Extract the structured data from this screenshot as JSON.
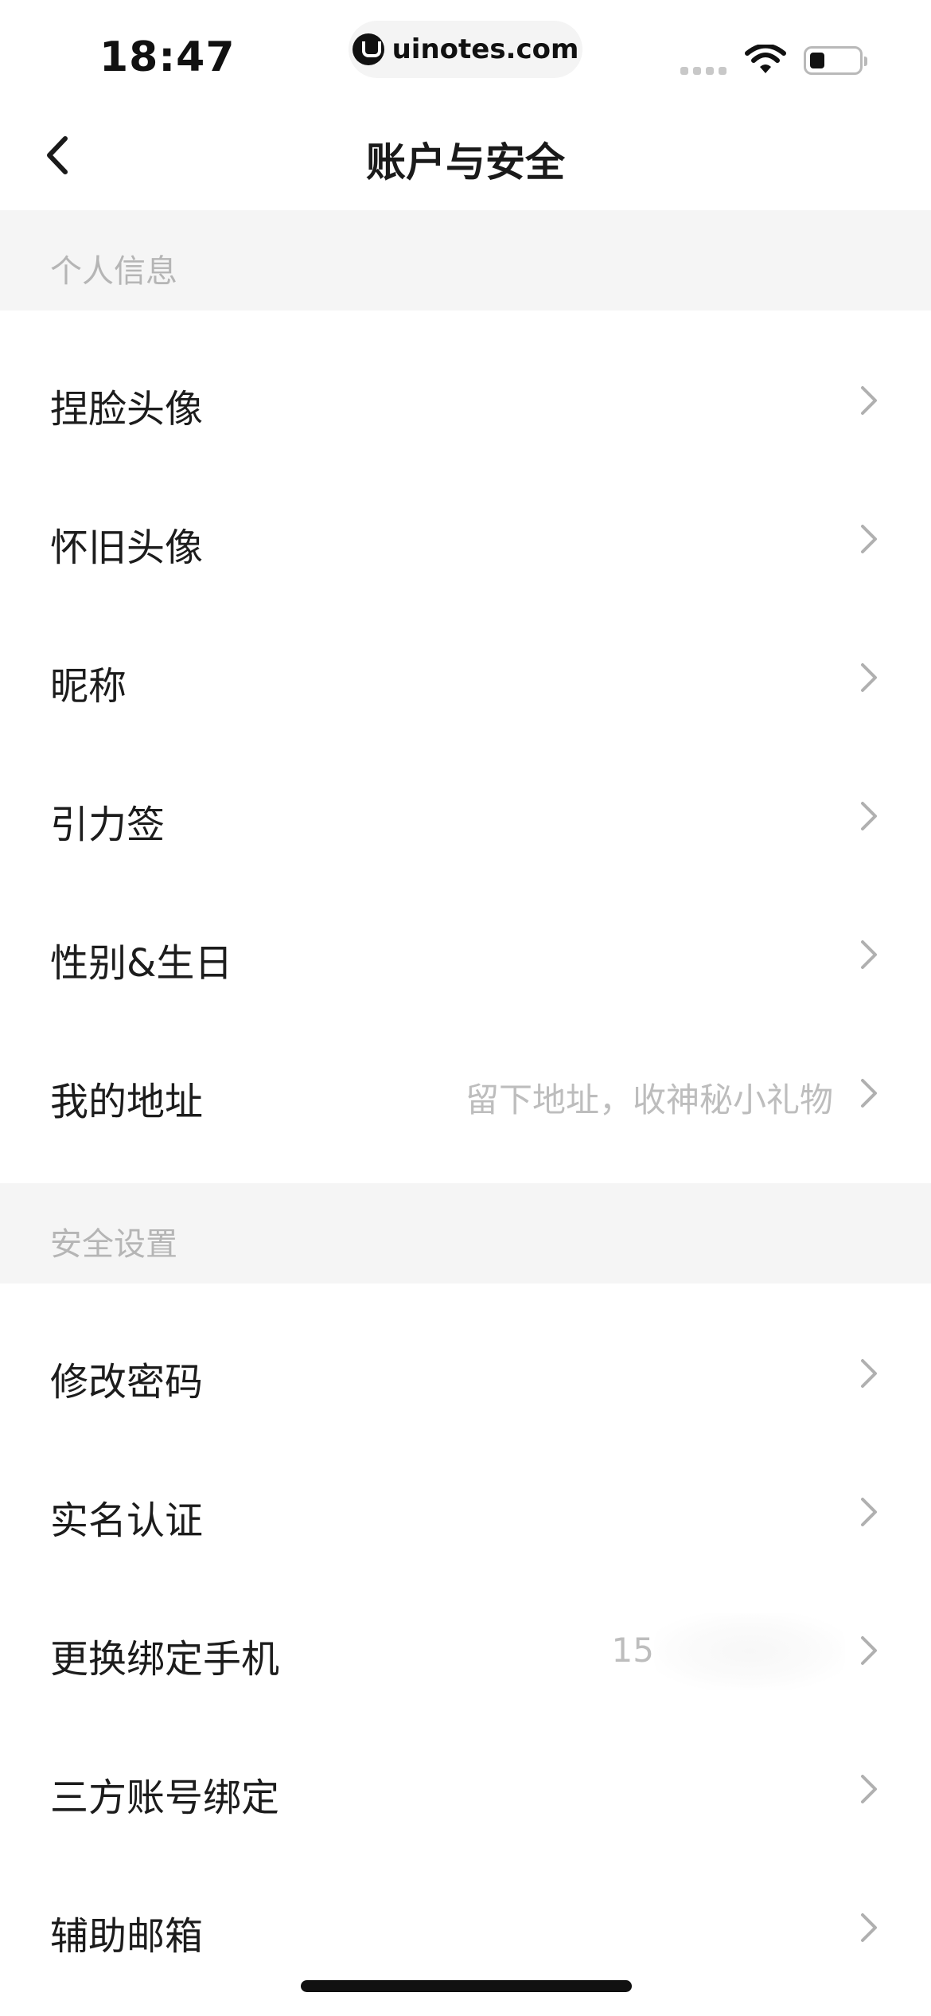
{
  "status_bar": {
    "time": "18:47",
    "site_label": "uinotes.com",
    "icons": [
      "signal-icon",
      "wifi-icon",
      "battery-icon"
    ]
  },
  "nav": {
    "title": "账户与安全",
    "back_icon": "chevron-left-icon"
  },
  "sections": {
    "personal": {
      "header": "个人信息",
      "items": [
        {
          "label": "捏脸头像",
          "value": ""
        },
        {
          "label": "怀旧头像",
          "value": ""
        },
        {
          "label": "昵称",
          "value": ""
        },
        {
          "label": "引力签",
          "value": ""
        },
        {
          "label": "性别&生日",
          "value": ""
        },
        {
          "label": "我的地址",
          "value": "留下地址，收神秘小礼物"
        }
      ]
    },
    "security": {
      "header": "安全设置",
      "items": [
        {
          "label": "修改密码",
          "value": ""
        },
        {
          "label": "实名认证",
          "value": ""
        },
        {
          "label": "更换绑定手机",
          "value": "15"
        },
        {
          "label": "三方账号绑定",
          "value": ""
        },
        {
          "label": "辅助邮箱",
          "value": ""
        }
      ]
    }
  },
  "colors": {
    "section_bg": "#f5f5f5",
    "section_text": "#b5b5b5",
    "row_text": "#1c1c1c",
    "value_text": "#bdbdbd",
    "chevron": "#b0b0b0"
  }
}
